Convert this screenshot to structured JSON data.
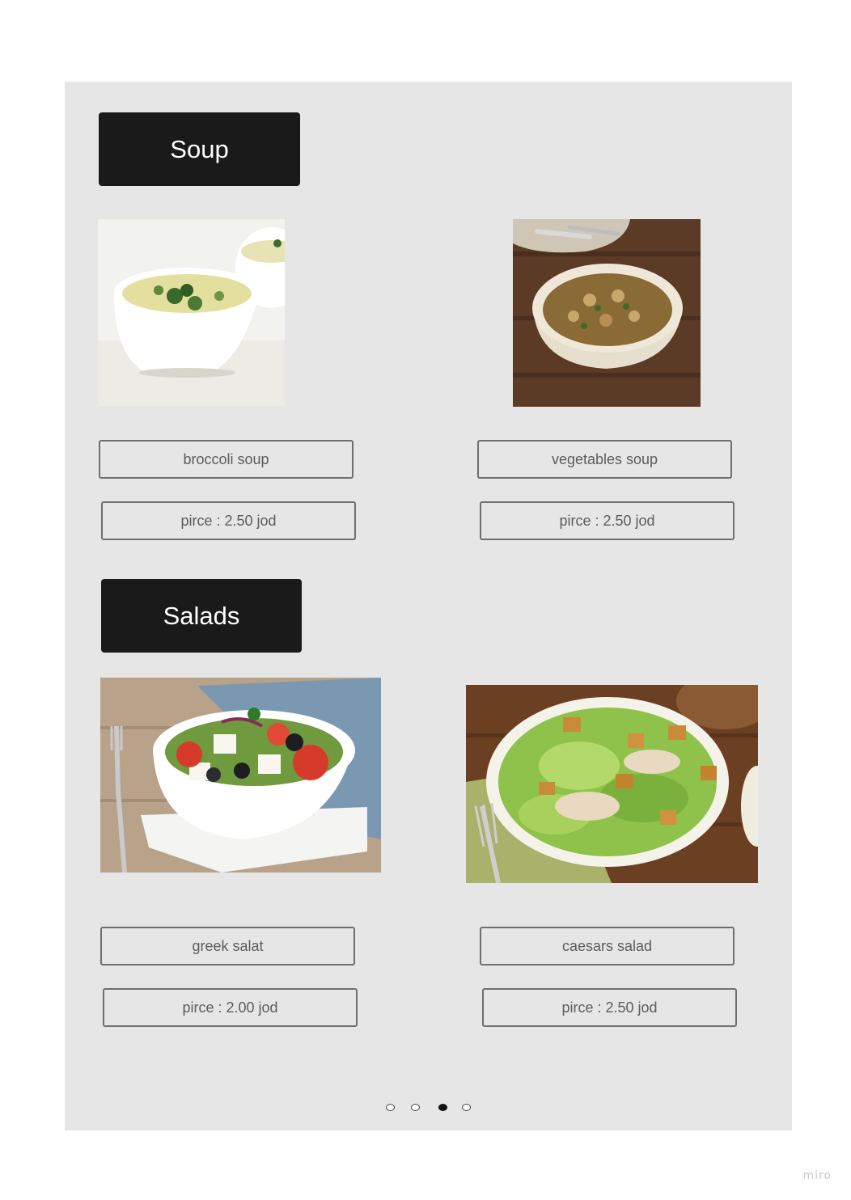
{
  "sections": [
    {
      "title": "Soup",
      "items": [
        {
          "name": "broccoli soup",
          "price": "pirce : 2.50 jod",
          "image_icon": "broccoli-soup-photo"
        },
        {
          "name": "vegetables soup",
          "price": "pirce : 2.50 jod",
          "image_icon": "vegetables-soup-photo"
        }
      ]
    },
    {
      "title": "Salads",
      "items": [
        {
          "name": "greek salat",
          "price": "pirce : 2.00 jod",
          "image_icon": "greek-salad-photo"
        },
        {
          "name": "caesars salad",
          "price": "pirce : 2.50 jod",
          "image_icon": "caesar-salad-photo"
        }
      ]
    }
  ],
  "pagination": {
    "total": 4,
    "active_index": 2
  },
  "watermark": "miro",
  "colors": {
    "board": "#e6e6e6",
    "header": "#1a1a1a",
    "border": "#6f6f6f",
    "text": "#5c5c5c"
  }
}
